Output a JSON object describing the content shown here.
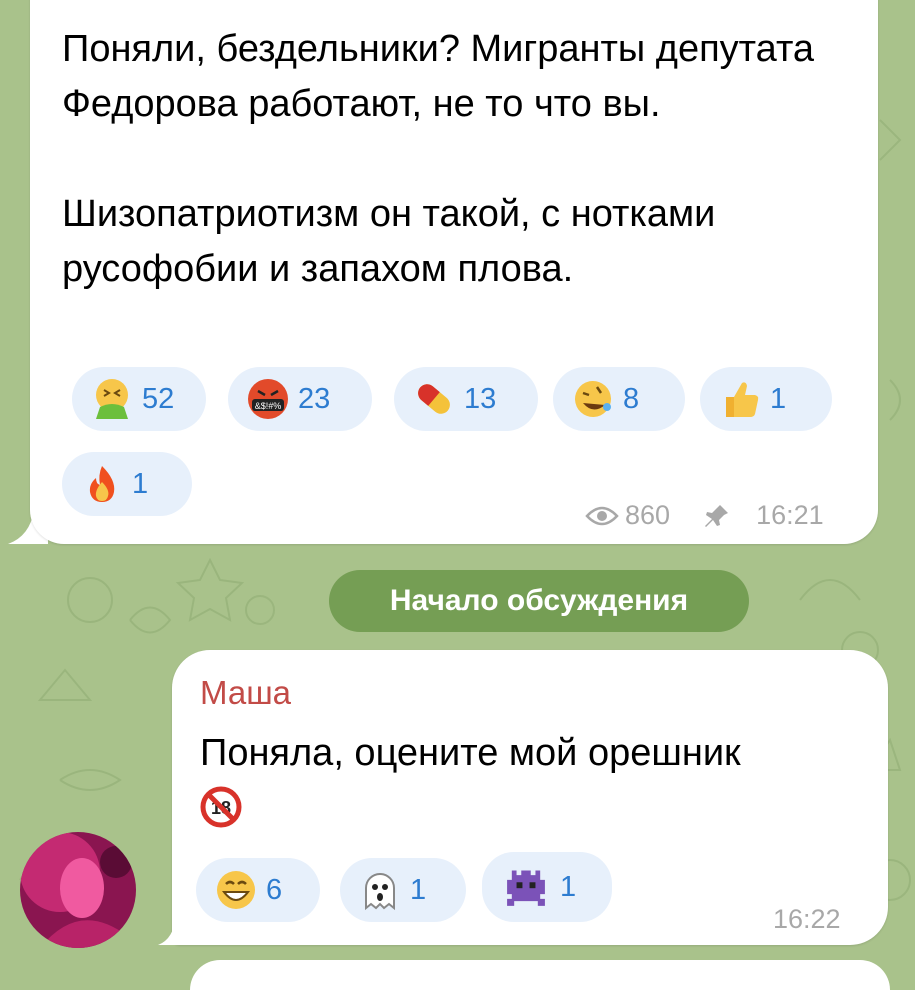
{
  "post": {
    "text": "Поняли, бездельники? Мигранты депутата Федорова работают, не то что вы.\n\nШизопатриотизм он такой, с нотками русофобии и запахом плова.",
    "reactions": [
      {
        "icon": "vomit-face-emoji",
        "count": "52"
      },
      {
        "icon": "cursing-face-emoji",
        "count": "23"
      },
      {
        "icon": "pill-emoji",
        "count": "13"
      },
      {
        "icon": "rofl-emoji",
        "count": "8"
      },
      {
        "icon": "thumbs-up-emoji",
        "count": "1"
      },
      {
        "icon": "fire-emoji",
        "count": "1"
      }
    ],
    "views": "860",
    "time": "16:21"
  },
  "service_message": "Начало обсуждения",
  "comment": {
    "sender": "Маша",
    "text": "Поняла, оцените мой орешник",
    "emoji_icon": "no-one-under-18-emoji",
    "reactions": [
      {
        "icon": "grinning-face-emoji",
        "count": "6"
      },
      {
        "icon": "ghost-emoji",
        "count": "1"
      },
      {
        "icon": "alien-monster-emoji",
        "count": "1"
      }
    ],
    "time": "16:22"
  },
  "colors": {
    "background": "#a9c28b",
    "reaction_bg": "#e7f0fb",
    "reaction_count": "#2d7cd0",
    "sender_name": "#c24b47",
    "service_bg": "#759e54"
  }
}
